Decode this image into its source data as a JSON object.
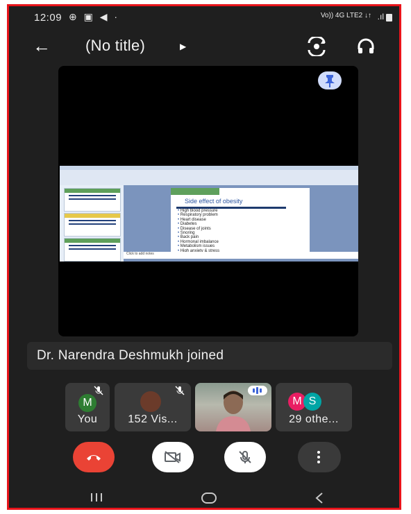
{
  "status": {
    "time": "12:09",
    "network": "Vo)) 4G LTE2 ↓↑"
  },
  "header": {
    "title": "(No title)"
  },
  "presentation": {
    "slide_title": "Side effect of obesity",
    "bullets": [
      "High blood pressure",
      "Respiratory problem",
      "Heart disease",
      "Diabetes",
      "Disease of joints",
      "Snoring",
      "Back pain",
      "Hormonal imbalance",
      "Metabolism issues",
      "High anxiety & stress"
    ],
    "notes_placeholder": "Click to add notes"
  },
  "notification": {
    "text": "Dr. Narendra Deshmukh joined"
  },
  "participants": [
    {
      "label": "You",
      "initial": "M",
      "color": "#2e7d32"
    },
    {
      "label": "152 Vis..."
    },
    {
      "label": ""
    },
    {
      "label": "29 othe...",
      "initials": [
        "M",
        "S"
      ],
      "colors": [
        "#e91e63",
        "#00a5a5"
      ]
    }
  ],
  "colors": {
    "end_call": "#ea4335",
    "frame": "#e8141b",
    "pin_bg": "#d0dcfb"
  }
}
